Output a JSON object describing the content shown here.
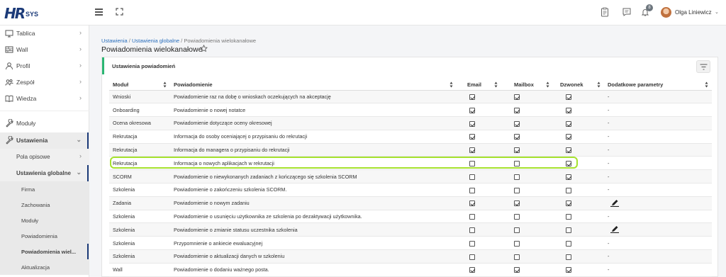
{
  "app": {
    "logo_main": "HR",
    "logo_sub": "SYS"
  },
  "header": {
    "user_name": "Olga Liniewicz",
    "notifications_count": "8"
  },
  "sidebar": {
    "items": [
      {
        "label": "Tablica",
        "icon": "monitor-icon"
      },
      {
        "label": "Wall",
        "icon": "wall-icon"
      },
      {
        "label": "Profil",
        "icon": "user-icon"
      },
      {
        "label": "Zespół",
        "icon": "team-icon"
      },
      {
        "label": "Wiedza",
        "icon": "book-icon"
      },
      {
        "label": "Moduły",
        "icon": "wrench-icon"
      },
      {
        "label": "Ustawienia",
        "icon": "settings-icon"
      }
    ],
    "sub_items": [
      {
        "label": "Pola opisowe"
      },
      {
        "label": "Ustawienia globalne"
      }
    ],
    "sub2_items": [
      {
        "label": "Firma"
      },
      {
        "label": "Zachowania"
      },
      {
        "label": "Moduły"
      },
      {
        "label": "Powiadomienia"
      },
      {
        "label": "Powiadomienia wiel..."
      },
      {
        "label": "Aktualizacja"
      }
    ]
  },
  "breadcrumb": {
    "link1": "Ustawienia",
    "sep1": " / ",
    "link2": "Ustawienia globalne",
    "sep2": " / ",
    "current": "Powiadomienia wielokanałowe"
  },
  "page": {
    "title": "Powiadomienia wielokanałowe"
  },
  "card": {
    "title": "Ustawienia powiadomień"
  },
  "table": {
    "headers": [
      "Moduł",
      "Powiadomienie",
      "Email",
      "Mailbox",
      "Dzwonek",
      "Dodatkowe parametry"
    ],
    "rows": [
      {
        "module": "Wnioski",
        "notification": "Powiadomienie raz na dobę o wnioskach oczekujących na akceptację",
        "email": true,
        "mailbox": true,
        "bell": true,
        "params": "-"
      },
      {
        "module": "Onboarding",
        "notification": "Powiadomienie o nowej notatce",
        "email": true,
        "mailbox": true,
        "bell": true,
        "params": "-"
      },
      {
        "module": "Ocena okresowa",
        "notification": "Powiadomienie dotyczące oceny okresowej",
        "email": true,
        "mailbox": true,
        "bell": true,
        "params": "-"
      },
      {
        "module": "Rekrutacja",
        "notification": "Informacja do osoby oceniającej o przypisaniu do rekrutacji",
        "email": true,
        "mailbox": true,
        "bell": true,
        "params": "-"
      },
      {
        "module": "Rekrutacja",
        "notification": "Informacja do managera o przypisaniu do rekrutacji",
        "email": true,
        "mailbox": true,
        "bell": true,
        "params": "-"
      },
      {
        "module": "Rekrutacja",
        "notification": "Informacja o nowych aplikacjach w rekrutacji",
        "email": false,
        "mailbox": false,
        "bell": true,
        "params": "-"
      },
      {
        "module": "SCORM",
        "notification": "Powiadomienie o niewykonanych zadaniach z kończącego się szkolenia SCORM",
        "email": false,
        "mailbox": false,
        "bell": true,
        "params": "-"
      },
      {
        "module": "Szkolenia",
        "notification": "Powiadomienie o zakończeniu szkolenia SCORM.",
        "email": false,
        "mailbox": false,
        "bell": false,
        "params": "-"
      },
      {
        "module": "Zadania",
        "notification": "Powiadomienie o nowym zadaniu",
        "email": true,
        "mailbox": true,
        "bell": true,
        "params": "edit"
      },
      {
        "module": "Szkolenia",
        "notification": "Powiadomienie o usunięciu użytkownika ze szkolenia po dezaktywacji użytkownika.",
        "email": false,
        "mailbox": false,
        "bell": false,
        "params": "-"
      },
      {
        "module": "Szkolenia",
        "notification": "Powiadomienie o zmianie statusu uczestnika szkolenia",
        "email": false,
        "mailbox": false,
        "bell": false,
        "params": "edit"
      },
      {
        "module": "Szkolenia",
        "notification": "Przypomnienie o ankiecie ewaluacyjnej",
        "email": false,
        "mailbox": false,
        "bell": false,
        "params": "-"
      },
      {
        "module": "Szkolenia",
        "notification": "Powiadomienie o aktualizacji danych w szkoleniu",
        "email": false,
        "mailbox": false,
        "bell": false,
        "params": "-"
      },
      {
        "module": "Wall",
        "notification": "Powiadomienie o dodaniu ważnego posta.",
        "email": true,
        "mailbox": true,
        "bell": true,
        "params": "-"
      }
    ]
  },
  "colors": {
    "brand": "#1b3a78",
    "accent_green": "#2bb673",
    "highlight": "#a6e22e",
    "link": "#2a6ebb"
  }
}
